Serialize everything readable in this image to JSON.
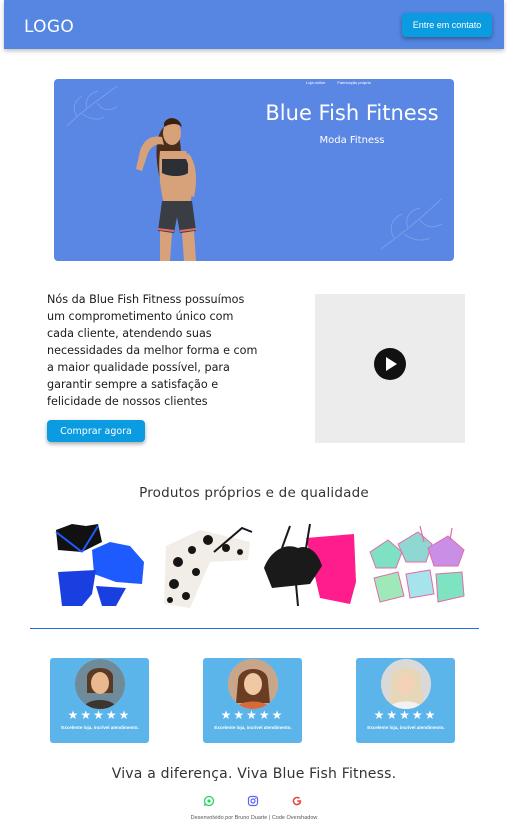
{
  "header": {
    "logo": "LOGO",
    "contact_button": "Entre em contato"
  },
  "hero": {
    "nav": [
      "Loja online",
      "Fabricação própria"
    ],
    "title": "Blue Fish Fitness",
    "subtitle": "Moda Fitness"
  },
  "about": {
    "text": "Nós da Blue Fish Fitness possuímos um comprometimento único com cada cliente, atendendo suas necessidades da melhor forma e com a maior qualidade possível, para garantir sempre a satisfação e felicidade de nossos clientes",
    "buy_button": "Comprar agora"
  },
  "video": {
    "play_icon": "play-icon"
  },
  "products": {
    "title": "Produtos próprios e de qualidade",
    "items": [
      "bikini-blue",
      "leggings-animal-print",
      "set-pink-black",
      "bikini-pastel"
    ]
  },
  "testimonials": [
    {
      "stars": "★★★★★",
      "text": "Excelente loja, incrível atendimento."
    },
    {
      "stars": "★★★★★",
      "text": "Excelente loja, incrível atendimento."
    },
    {
      "stars": "★★★★★",
      "text": "Excelente loja, incrível atendimento."
    }
  ],
  "footer": {
    "slogan": "Viva a diferença. Viva Blue Fish Fitness.",
    "social": [
      "whatsapp-icon",
      "instagram-icon",
      "google-icon"
    ],
    "credit": "Desenvolvido por Bruno Duarte | Code Overshadow"
  },
  "colors": {
    "header": "#5486e2",
    "accent": "#0a9be0",
    "card": "#5bb4ea",
    "divider": "#1c6fe0"
  }
}
